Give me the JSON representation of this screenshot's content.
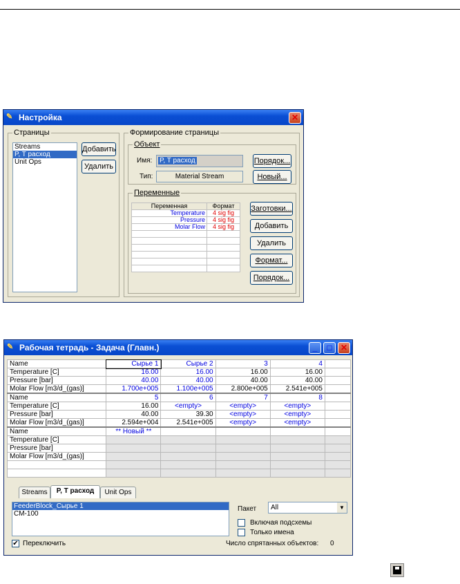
{
  "setup": {
    "title": "Настройка",
    "pages_group": "Страницы",
    "pages": [
      "Streams",
      "P, T расход",
      "Unit Ops"
    ],
    "add_btn": "Добавить",
    "del_btn": "Удалить",
    "form_group": "Формирование страницы",
    "obj_group": "Объект",
    "name_label": "Имя:",
    "name_value": "P, T расход",
    "order_btn": "Порядок...",
    "type_label": "Тип:",
    "type_value": "Material Stream",
    "new_btn": "Новый...",
    "vars_group": "Переменные",
    "var_headers": [
      "Переменная",
      "Формат"
    ],
    "vars": [
      {
        "name": "Temperature",
        "format": "4 sig fig"
      },
      {
        "name": "Pressure",
        "format": "4 sig fig"
      },
      {
        "name": "Molar Flow",
        "format": "4 sig fig"
      }
    ],
    "presets_btn": "Заготовки...",
    "add2_btn": "Добавить",
    "del2_btn": "Удалить",
    "format_btn": "Формат...",
    "order2_btn": "Порядок..."
  },
  "workbook": {
    "title": "Рабочая тетрадь - Задача (Главн.)",
    "blocks": [
      {
        "header": [
          "Name",
          "Сырье 1",
          "Сырье 2",
          "3",
          "4"
        ],
        "rows": [
          [
            "Temperature [C]",
            "16.00",
            "16.00",
            "16.00",
            "16.00"
          ],
          [
            "Pressure [bar]",
            "40.00",
            "40.00",
            "40.00",
            "40.00"
          ],
          [
            "Molar Flow [m3/d_(gas)]",
            "1.700e+005",
            "1.100e+005",
            "2.800e+005",
            "2.541e+005"
          ]
        ]
      },
      {
        "header": [
          "Name",
          "5",
          "6",
          "7",
          "8"
        ],
        "rows": [
          [
            "Temperature [C]",
            "16.00",
            "<empty>",
            "<empty>",
            "<empty>"
          ],
          [
            "Pressure [bar]",
            "40.00",
            "39.30",
            "<empty>",
            "<empty>"
          ],
          [
            "Molar Flow [m3/d_(gas)]",
            "2.594e+004",
            "2.541e+005",
            "<empty>",
            "<empty>"
          ]
        ]
      },
      {
        "header": [
          "Name",
          "** Новый **",
          "",
          "",
          ""
        ],
        "rows": [
          [
            "Temperature [C]",
            "",
            "",
            "",
            ""
          ],
          [
            "Pressure [bar]",
            "",
            "",
            "",
            ""
          ],
          [
            "Molar Flow [m3/d_(gas)]",
            "",
            "",
            "",
            ""
          ]
        ]
      }
    ],
    "tabs": [
      "Streams",
      "P, T расход",
      "Unit Ops"
    ],
    "objects": [
      "FeederBlock_Сырье 1",
      "CM-100"
    ],
    "packet_label": "Пакет",
    "packet_value": "All",
    "include_sub": "Включая подсхемы",
    "names_only": "Только имена",
    "toggle_label": "Переключить",
    "hidden_label": "Число спрятанных объектов:",
    "hidden_count": "0"
  },
  "colors": {
    "accent": "#0a4fd4",
    "blue_value": "#0000e0",
    "red_value": "#e00000"
  }
}
